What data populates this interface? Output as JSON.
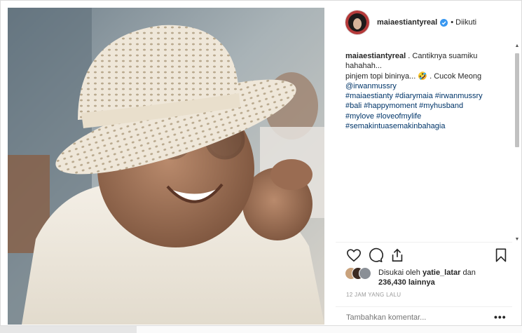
{
  "post": {
    "username": "maiaestiantyreal",
    "verified_icon": "verified-badge-icon",
    "follow_status": "• Diikuti",
    "caption_lines": [
      ". Cantiknya suamiku",
      "hahahah...",
      "pinjem topi bininya... 🤣 . Cucok Meong",
      "@irwanmussry",
      "#maiaestianty #diarymaia #irwanmussry",
      "#bali #happymoment #myhusband",
      "#mylove #loveofmylife",
      "#semakintuasemakinbahagia"
    ],
    "likes_prefix": "Disukai oleh",
    "liked_by": "yatie_latar",
    "likes_and": "dan",
    "likes_count": "236,430",
    "likes_suffix": "lainnya",
    "timestamp": "12 JAM YANG LALU",
    "comment_placeholder": "Tambahkan komentar...",
    "more_label": "•••"
  },
  "icons": {
    "like": "heart-icon",
    "comment": "comment-icon",
    "share": "share-icon",
    "save": "bookmark-icon"
  },
  "colors": {
    "text": "#262626",
    "link": "#003569",
    "muted": "#999999",
    "verified": "#3897f0",
    "border": "#dbdbdb"
  }
}
